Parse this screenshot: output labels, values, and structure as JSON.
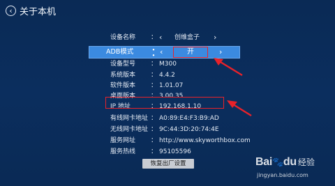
{
  "header": {
    "back_icon": "‹",
    "title": "关于本机"
  },
  "device_name": {
    "label": "设备名称",
    "value": "创维盒子",
    "left": "‹",
    "right": "›"
  },
  "adb": {
    "label": "ADB模式",
    "value": "开",
    "left": "‹",
    "right": "›"
  },
  "info_rows": [
    {
      "label": "设备型号",
      "value": "M300"
    },
    {
      "label": "系统版本",
      "value": "4.4.2"
    },
    {
      "label": "软件版本",
      "value": "1.01.07"
    },
    {
      "label": "桌面版本",
      "value": "3.00.35"
    },
    {
      "label": "IP  地址",
      "value": "192.168.1.10"
    },
    {
      "label": "有线网卡地址",
      "value": "A0:89:E4:F3:B9:AD"
    },
    {
      "label": "无线网卡地址",
      "value": "9C:44:3D:20:74:4E"
    },
    {
      "label": "服务网址",
      "value": "http://www.skyworthbox.com"
    },
    {
      "label": "服务热线",
      "value": "95105596"
    }
  ],
  "colon": "：",
  "reset_button": "恢复出厂设置",
  "watermark": {
    "logo": "Bai",
    "logo2": "du",
    "sub": "经验",
    "url": "jingyan.baidu.com"
  },
  "colors": {
    "background": "#0b2e5e",
    "highlight_bar": "#3b8ae0",
    "annotation_red": "#e8222a"
  }
}
